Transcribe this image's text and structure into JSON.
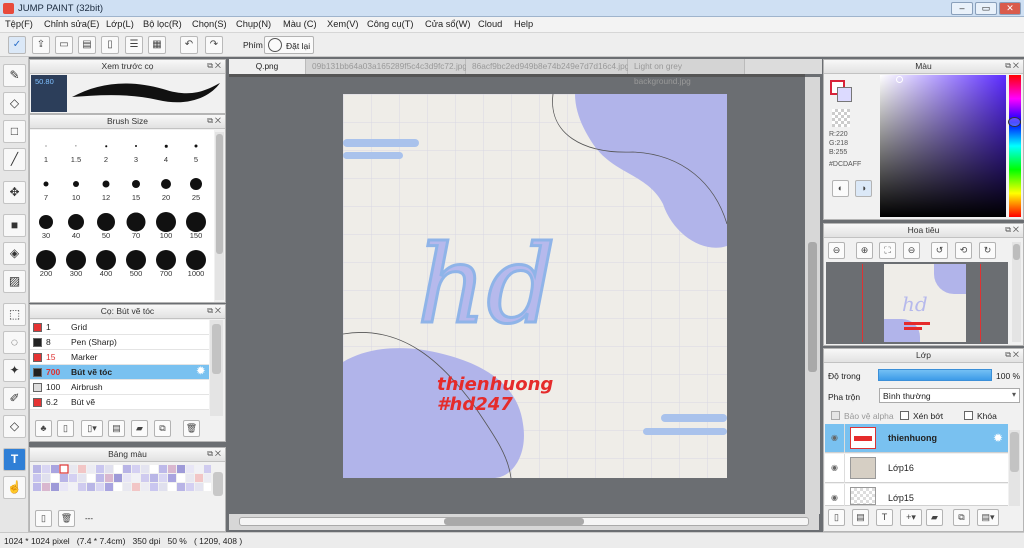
{
  "window": {
    "title": "JUMP PAINT (32bit)",
    "min": "–",
    "max": "▭",
    "close": "✕"
  },
  "menu": [
    "Tệp(F)",
    "Chỉnh sửa(E)",
    "Lớp(L)",
    "Bộ lọc(R)",
    "Chọn(S)",
    "Chụp(N)",
    "Màu (C)",
    "Xem(V)",
    "Công cụ(T)",
    "Cửa sổ(W)",
    "Cloud",
    "Help"
  ],
  "toolbar": {
    "key_label": "Phím",
    "reset_label": "Đặt lại"
  },
  "preview": {
    "title": "Xem trước cọ",
    "size_value": "50.80"
  },
  "brush_size": {
    "title": "Brush Size",
    "sizes": [
      "1",
      "1.5",
      "2",
      "3",
      "4",
      "5",
      "7",
      "10",
      "12",
      "15",
      "20",
      "25",
      "30",
      "40",
      "50",
      "70",
      "100",
      "150",
      "200",
      "300",
      "400",
      "500",
      "700",
      "1000"
    ]
  },
  "brush_list": {
    "title": "Cọ: Bút vẽ tóc",
    "items": [
      {
        "size": "1",
        "name": "Grid",
        "color": "#e53333"
      },
      {
        "size": "8",
        "name": "Pen (Sharp)",
        "color": "#222222"
      },
      {
        "size": "15",
        "name": "Marker",
        "color": "#e53333"
      },
      {
        "size": "700",
        "name": "Bút vẽ tóc",
        "color": "#222222"
      },
      {
        "size": "100",
        "name": "Airbrush",
        "color": "#dddddd"
      },
      {
        "size": "6.2",
        "name": "Bút vẽ",
        "color": "#e53333"
      }
    ]
  },
  "palette": {
    "title": "Bảng màu",
    "footer_text": "---"
  },
  "tabs": [
    "Q.png",
    "09b131bb64a03a165289f5c4c3d9fc72.jpg",
    "86acf9bc2ed949b8e74b249e7d7d16c4.jpg",
    "Light on grey background.jpg"
  ],
  "canvas": {
    "line1": "thienhuong",
    "line2": "#hd247",
    "big_text": "hd"
  },
  "color_panel": {
    "title": "Màu",
    "r": "R:220",
    "g": "G:218",
    "b": "B:255",
    "hex": "#DCDAFF"
  },
  "navigator": {
    "title": "Hoa tiêu"
  },
  "layers": {
    "title": "Lớp",
    "opacity_label": "Độ trong",
    "opacity_value": "100 %",
    "blend_label": "Pha trộn",
    "blend_value": "Bình thường",
    "protect_alpha": "Bảo vệ alpha",
    "clip_label": "Xén bớt",
    "lock_label": "Khóa",
    "items": [
      "thienhuong",
      "Lớp16",
      "Lớp15"
    ]
  },
  "status": {
    "text": "1024 * 1024 pixel   (7.4 * 7.4cm)   350 dpi   50 %   ( 1209, 408 )"
  }
}
